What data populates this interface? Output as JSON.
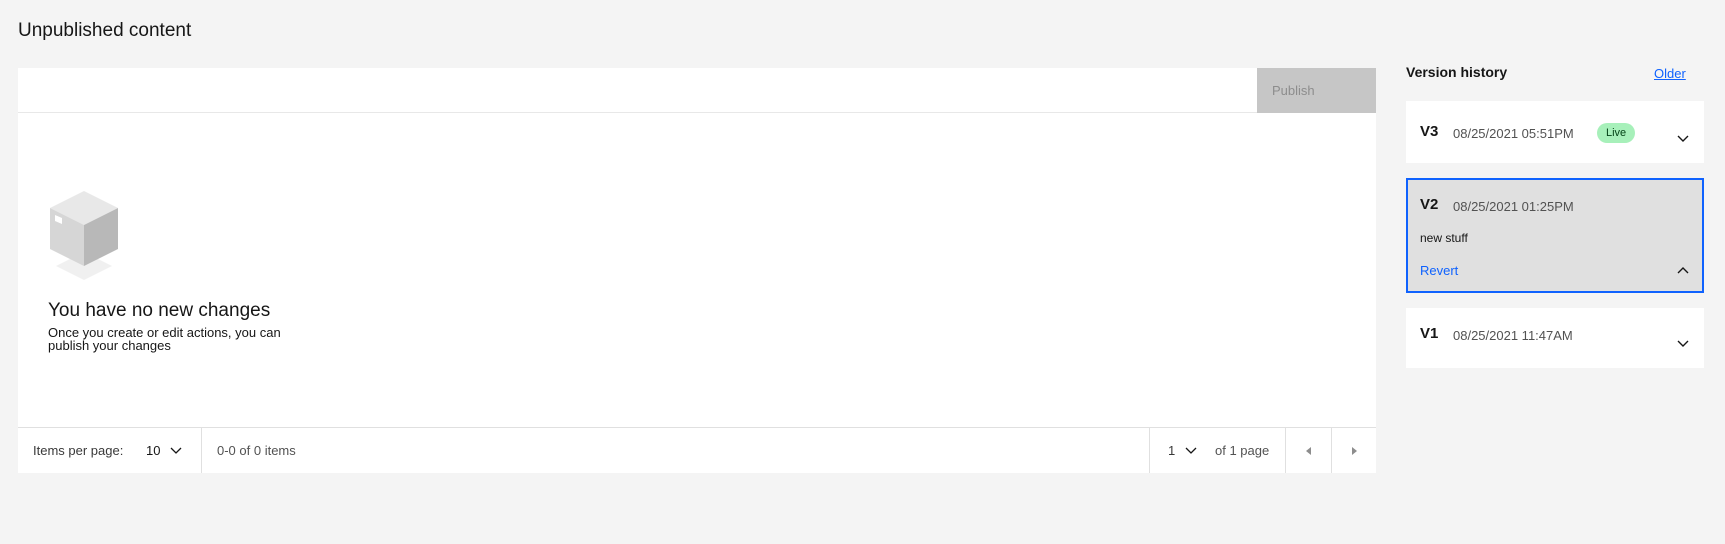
{
  "page": {
    "title": "Unpublished content"
  },
  "toolbar": {
    "publish_label": "Publish"
  },
  "empty_state": {
    "title": "You have no new changes",
    "description": "Once you create or edit actions, you can publish your changes"
  },
  "pagination": {
    "items_per_page_label": "Items per page:",
    "items_per_page_value": "10",
    "range_text": "0-0 of 0 items",
    "page_value": "1",
    "of_pages_text": "of 1 page"
  },
  "version_history": {
    "title": "Version history",
    "older_label": "Older",
    "versions": [
      {
        "label": "V3",
        "date": "08/25/2021 05:51PM",
        "badge": "Live"
      },
      {
        "label": "V2",
        "date": "08/25/2021 01:25PM",
        "note": "new stuff",
        "action": "Revert"
      },
      {
        "label": "V1",
        "date": "08/25/2021 11:47AM"
      }
    ]
  },
  "colors": {
    "accent": "#0f62fe",
    "live_badge_bg": "#a7f0ba",
    "disabled_button": "#c6c6c6"
  }
}
